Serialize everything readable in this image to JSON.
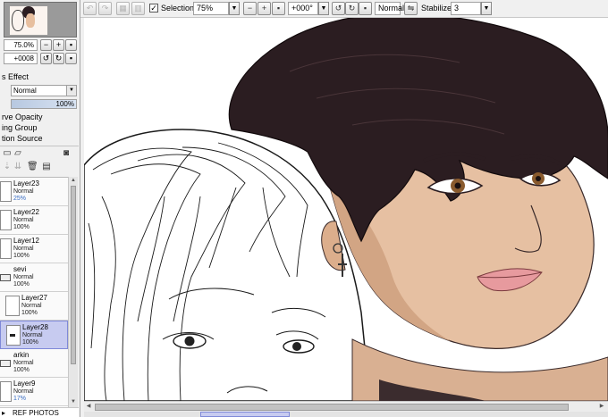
{
  "toolbar": {
    "selection_label": "Selection",
    "selection_checked": "✓",
    "zoom_value": "75%",
    "rotation_value": "+000°",
    "blend_value": "Normal",
    "stabilizer_label": "Stabilizer",
    "stabilizer_value": "3"
  },
  "navigator": {
    "zoom": "75.0%",
    "rotation": "+0008"
  },
  "layer_panel": {
    "effect_label": "s Effect",
    "blend_mode": "Normal",
    "opacity": "100%",
    "options": [
      "rve Opacity",
      "ing Group",
      "tion Source"
    ],
    "ref_photos": "REF PHOTOS"
  },
  "layers": [
    {
      "name": "Layer23",
      "mode": "Normal",
      "opacity": "25%"
    },
    {
      "name": "Layer22",
      "mode": "Normal",
      "opacity": "100%"
    },
    {
      "name": "Layer12",
      "mode": "Normal",
      "opacity": "100%"
    },
    {
      "name": "sevi",
      "mode": "Normal",
      "opacity": "100%"
    },
    {
      "name": "Layer27",
      "mode": "Normal",
      "opacity": "100%"
    },
    {
      "name": "Layer28",
      "mode": "Normal",
      "opacity": "100%",
      "selected": true
    },
    {
      "name": "arkin",
      "mode": "Normal",
      "opacity": "100%"
    },
    {
      "name": "Layer9",
      "mode": "Normal",
      "opacity": "17%"
    }
  ],
  "colors": {
    "hair_dark": "#2b1d21",
    "skin": "#e6c0a2",
    "skin_shadow": "#d2a584",
    "lips": "#e79a9e",
    "selected_layer": "#c7cbf0"
  }
}
